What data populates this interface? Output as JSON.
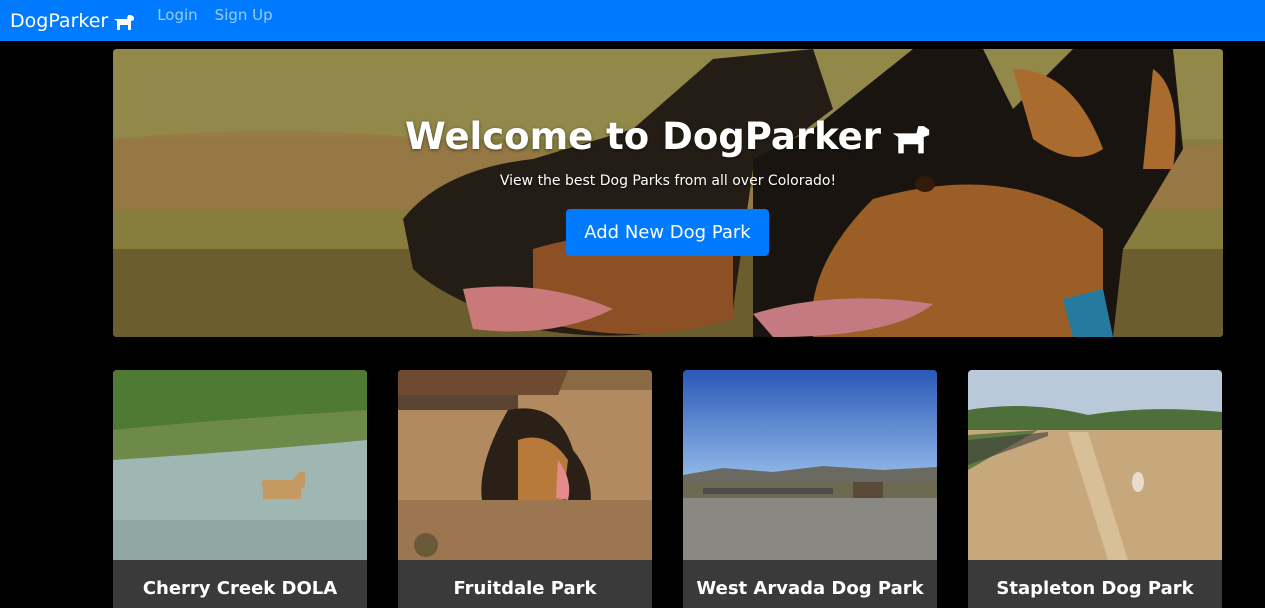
{
  "nav": {
    "brand": "DogParker",
    "links": [
      "Login",
      "Sign Up"
    ]
  },
  "hero": {
    "title": "Welcome to DogParker",
    "subtitle": "View the best Dog Parks from all over Colorado!",
    "button_label": "Add New Dog Park"
  },
  "parks": [
    {
      "name": "Cherry Creek DOLA"
    },
    {
      "name": "Fruitdale Park"
    },
    {
      "name": "West Arvada Dog Park"
    },
    {
      "name": "Stapleton Dog Park"
    }
  ],
  "colors": {
    "primary": "#007bff",
    "card_bg": "#3a3a3a"
  }
}
